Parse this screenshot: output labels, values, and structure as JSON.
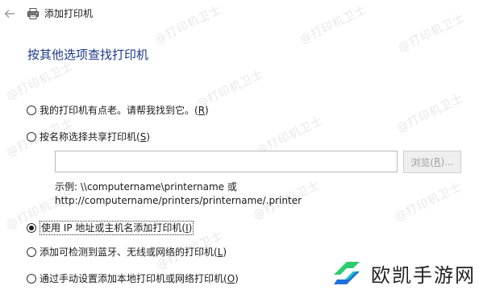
{
  "window": {
    "title": "添加打印机"
  },
  "heading": "按其他选项查找打印机",
  "options": [
    {
      "pre": "我的打印机有点老。请帮我找到它。(",
      "key": "R",
      "post": ")",
      "selected": false
    },
    {
      "pre": "按名称选择共享打印机(",
      "key": "S",
      "post": ")",
      "selected": false
    },
    {
      "pre": "使用 IP 地址或主机名添加打印机(",
      "key": "I",
      "post": ")",
      "selected": true
    },
    {
      "pre": "添加可检测到蓝牙、无线或网络的打印机(",
      "key": "L",
      "post": ")",
      "selected": false
    },
    {
      "pre": "通过手动设置添加本地打印机或网络打印机(",
      "key": "O",
      "post": ")",
      "selected": false
    }
  ],
  "share_input": {
    "value": ""
  },
  "browse_button": {
    "pre": "浏览(",
    "key": "R",
    "post": ")..."
  },
  "example": {
    "line1": "示例: \\\\computername\\printername 或",
    "line2": "http://computername/printers/printername/.printer"
  },
  "watermark_text": "@打印机卫士",
  "brand": {
    "name": "欧凯手游网",
    "logo_icon": "brand-logo-icon",
    "colors": {
      "green": "#2ecc71",
      "blue": "#1e6fd9"
    }
  },
  "colors": {
    "heading": "#1e3a8a",
    "disabled_text": "#9f9f9f"
  }
}
